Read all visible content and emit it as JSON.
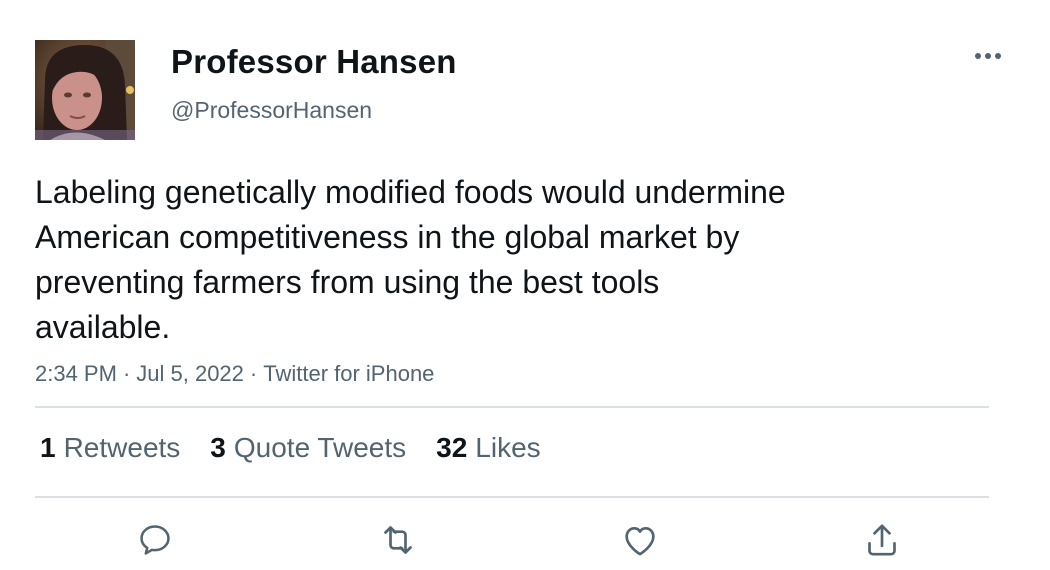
{
  "tweet": {
    "author": {
      "display_name": "Professor Hansen",
      "handle": "@ProfessorHansen"
    },
    "text_lines": [
      "Labeling genetically modified foods would undermine",
      "American competitiveness in the global market by",
      "preventing farmers from using the best tools",
      "available."
    ],
    "meta": {
      "time": "2:34 PM",
      "date": "Jul 5, 2022",
      "source": "Twitter for iPhone",
      "separator": "·"
    },
    "stats": {
      "retweets": {
        "count": "1",
        "label": "Retweets"
      },
      "quotes": {
        "count": "3",
        "label": "Quote Tweets"
      },
      "likes": {
        "count": "32",
        "label": "Likes"
      }
    }
  },
  "icons": {
    "more": "more-dots-icon",
    "reply": "reply-icon",
    "retweet": "retweet-icon",
    "like": "heart-icon",
    "share": "share-icon"
  },
  "colors": {
    "primary_text": "#0f1419",
    "secondary_text": "#536471",
    "divider": "#dcdfe2",
    "icon": "#536471"
  }
}
